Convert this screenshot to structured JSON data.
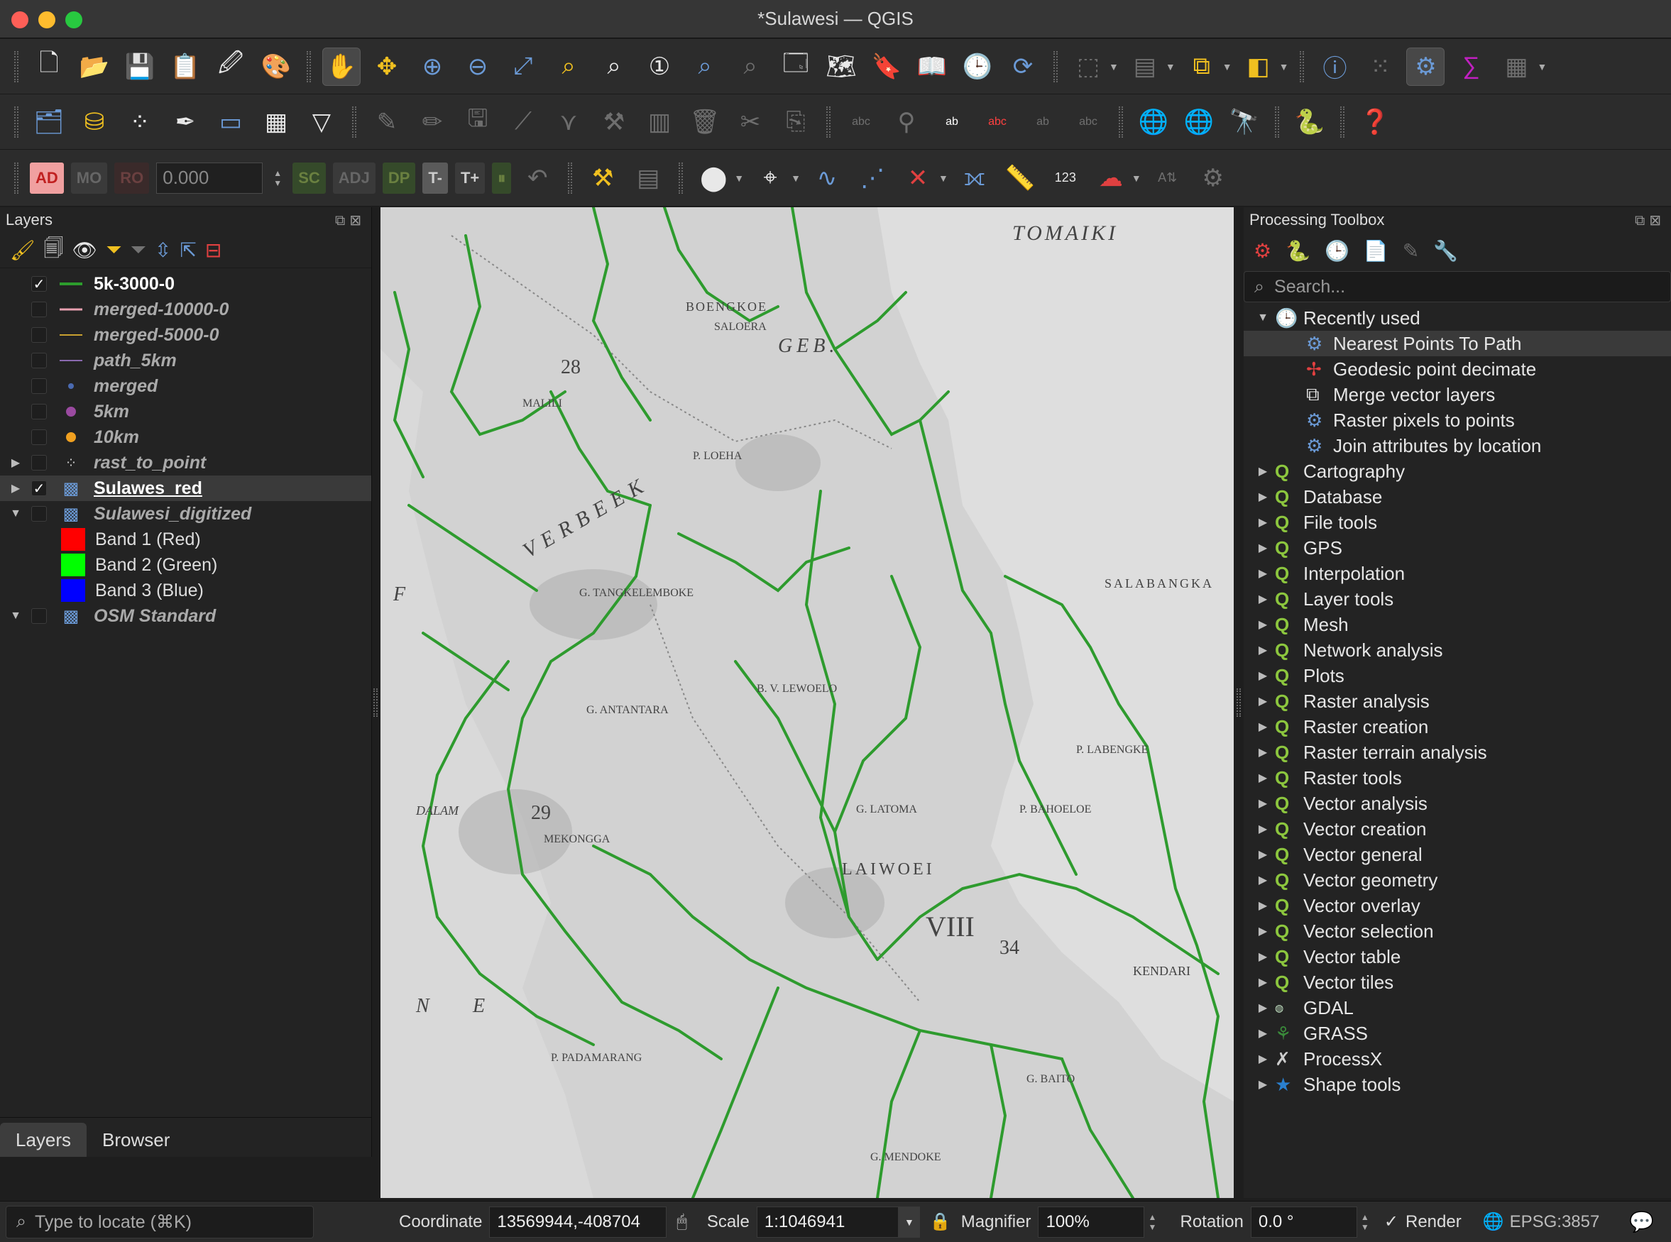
{
  "window": {
    "title": "*Sulawesi — QGIS"
  },
  "toolbar1": {
    "icons": [
      "new-project-icon",
      "open-project-icon",
      "save-project-icon",
      "new-print-layout-icon",
      "style-manager-icon",
      "python-icon",
      "pan-icon",
      "pan-to-selection-icon",
      "zoom-in-icon",
      "zoom-out-icon",
      "zoom-full-icon",
      "zoom-to-selection-icon",
      "zoom-to-layer-icon",
      "zoom-native-icon",
      "zoom-last-icon",
      "zoom-next-icon",
      "new-bookmark-icon",
      "show-bookmarks-icon",
      "temporal-controller-icon",
      "refresh-icon",
      "identify-icon",
      "statistics-icon",
      "processing-icon",
      "sum-icon",
      "attribute-table-icon"
    ]
  },
  "toolbar3": {
    "ad": "AD",
    "mo": "MO",
    "ro": "RO",
    "angle_value": "0.000",
    "sc": "SC",
    "adj": "ADJ",
    "tminus": "T-",
    "tplus": "T+"
  },
  "layers_panel": {
    "title": "Layers",
    "layers": [
      {
        "name": "5k-3000-0",
        "checked": true,
        "style": "bold"
      },
      {
        "name": "merged-10000-0",
        "checked": false,
        "style": "ital"
      },
      {
        "name": "merged-5000-0",
        "checked": false,
        "style": "ital"
      },
      {
        "name": "path_5km",
        "checked": false,
        "style": "ital"
      },
      {
        "name": "merged",
        "checked": false,
        "style": "ital"
      },
      {
        "name": "5km",
        "checked": false,
        "style": "ital"
      },
      {
        "name": "10km",
        "checked": false,
        "style": "ital"
      },
      {
        "name": "rast_to_point",
        "checked": false,
        "style": "ital"
      },
      {
        "name": "Sulawes_red",
        "checked": true,
        "style": "bold-ul"
      },
      {
        "name": "Sulawesi_digitized",
        "checked": false,
        "style": "ital"
      },
      {
        "name": "Band 1 (Red)",
        "color": "#ff0000"
      },
      {
        "name": "Band 2 (Green)",
        "color": "#00ff00"
      },
      {
        "name": "Band 3 (Blue)",
        "color": "#0000ff"
      },
      {
        "name": "OSM Standard",
        "checked": false,
        "style": "ital"
      }
    ],
    "tabs": [
      "Layers",
      "Browser"
    ]
  },
  "map": {
    "labels": [
      "TOMAIKI",
      "BOENGKOE",
      "SALOERA",
      "GEB.",
      "P. LOEHA",
      "G. TANGKELEMBOKE",
      "VERBEEK",
      "G. ANTANTARA",
      "B. V. LEWOELO",
      "G. LATOMA",
      "LAIWOEI",
      "MEKONGGA",
      "P. PADAMARANG",
      "SALABANGKA",
      "MALILI",
      "P. LABENGKE",
      "P. BAHOELOE",
      "KENDARI",
      "G. MENDOKE",
      "G. BAITO",
      "DALAM",
      "F",
      "N",
      "E",
      "VIII",
      "28",
      "29",
      "34"
    ]
  },
  "processing": {
    "title": "Processing Toolbox",
    "search_placeholder": "Search...",
    "recent_label": "Recently used",
    "recent": [
      "Nearest Points To Path",
      "Geodesic point decimate",
      "Merge vector layers",
      "Raster pixels to points",
      "Join attributes by location"
    ],
    "groups": [
      "Cartography",
      "Database",
      "File tools",
      "GPS",
      "Interpolation",
      "Layer tools",
      "Mesh",
      "Network analysis",
      "Plots",
      "Raster analysis",
      "Raster creation",
      "Raster terrain analysis",
      "Raster tools",
      "Vector analysis",
      "Vector creation",
      "Vector general",
      "Vector geometry",
      "Vector overlay",
      "Vector selection",
      "Vector table",
      "Vector tiles"
    ],
    "providers": [
      "GDAL",
      "GRASS",
      "ProcessX",
      "Shape tools"
    ]
  },
  "statusbar": {
    "locate_placeholder": "Type to locate (⌘K)",
    "coordinate_label": "Coordinate",
    "coordinate_value": "13569944,-408704",
    "scale_label": "Scale",
    "scale_value": "1:1046941",
    "magnifier_label": "Magnifier",
    "magnifier_value": "100%",
    "rotation_label": "Rotation",
    "rotation_value": "0.0 °",
    "render_label": "Render",
    "crs": "EPSG:3857"
  }
}
